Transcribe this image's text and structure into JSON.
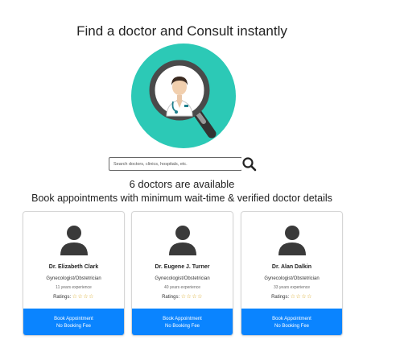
{
  "page": {
    "title": "Find a doctor and Consult instantly",
    "hero_icon": "doctor-magnifier-icon"
  },
  "search": {
    "placeholder": "Search doctors, clinics, hospitals, etc.",
    "button_icon": "search-icon"
  },
  "results": {
    "count_text": "6 doctors are available",
    "subtitle": "Book appointments with minimum wait-time & verified doctor details"
  },
  "colors": {
    "accent": "#0a84ff",
    "hero_circle": "#2cc9b6",
    "star": "#d6a418",
    "avatar": "#3a3a3a"
  },
  "doctors": [
    {
      "name": "Dr. Elizabeth Clark",
      "specialty": "Gynecologist/Obstetrician",
      "experience": "11 years experience",
      "ratings_label": "Ratings:",
      "stars": "☆☆☆☆",
      "book_label": "Book Appointment",
      "fee_label": "No Booking Fee"
    },
    {
      "name": "Dr. Eugene J. Turner",
      "specialty": "Gynecologist/Obstetrician",
      "experience": "40 years experience",
      "ratings_label": "Ratings:",
      "stars": "☆☆☆☆",
      "book_label": "Book Appointment",
      "fee_label": "No Booking Fee"
    },
    {
      "name": "Dr. Alan Dalkin",
      "specialty": "Gynecologist/Obstetrician",
      "experience": "33 years experience",
      "ratings_label": "Ratings:",
      "stars": "☆☆☆☆",
      "book_label": "Book Appointment",
      "fee_label": "No Booking Fee"
    }
  ]
}
